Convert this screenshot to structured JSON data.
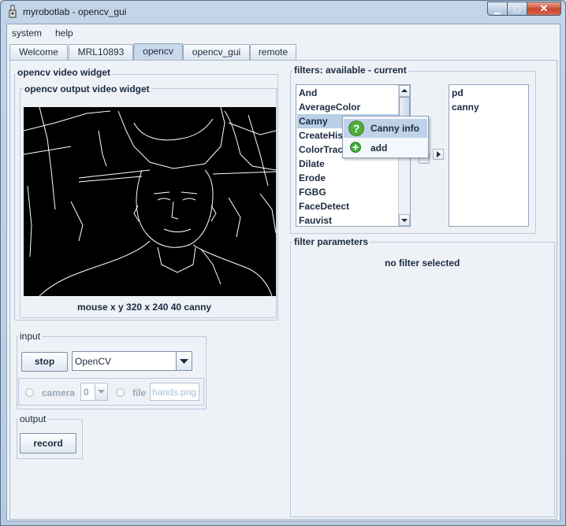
{
  "window": {
    "title": "myrobotlab - opencv_gui"
  },
  "menu": {
    "items": [
      "system",
      "help"
    ]
  },
  "tabs": [
    {
      "label": "Welcome",
      "active": false
    },
    {
      "label": "MRL10893",
      "active": false
    },
    {
      "label": "opencv",
      "active": true
    },
    {
      "label": "opencv_gui",
      "active": false
    },
    {
      "label": "remote",
      "active": false
    }
  ],
  "video_panel": {
    "outer_title": "opencv  video widget",
    "inner_title": "opencv output video widget",
    "status": "mouse x y  320 x 240  40  canny"
  },
  "input": {
    "title": "input",
    "stop_label": "stop",
    "source_selected": "OpenCV",
    "camera_label": "camera",
    "camera_index": "0",
    "file_label": "file",
    "file_value": "hands.png"
  },
  "output": {
    "title": "output",
    "record_label": "record"
  },
  "filters": {
    "title": "filters: available - current",
    "available": [
      "And",
      "AverageColor",
      "Canny",
      "CreateHistogram",
      "ColorTrack",
      "Dilate",
      "Erode",
      "FGBG",
      "FaceDetect",
      "Fauvist"
    ],
    "selected_available": "Canny",
    "current": [
      "pd",
      "canny"
    ]
  },
  "context_menu": {
    "items": [
      {
        "label": "Canny info",
        "icon": "help-icon"
      },
      {
        "label": "add",
        "icon": "add-icon"
      }
    ]
  },
  "params": {
    "title": "filter parameters",
    "message": "no filter selected"
  },
  "colors": {
    "accent": "#b9cfe6",
    "close": "#c7452d"
  }
}
